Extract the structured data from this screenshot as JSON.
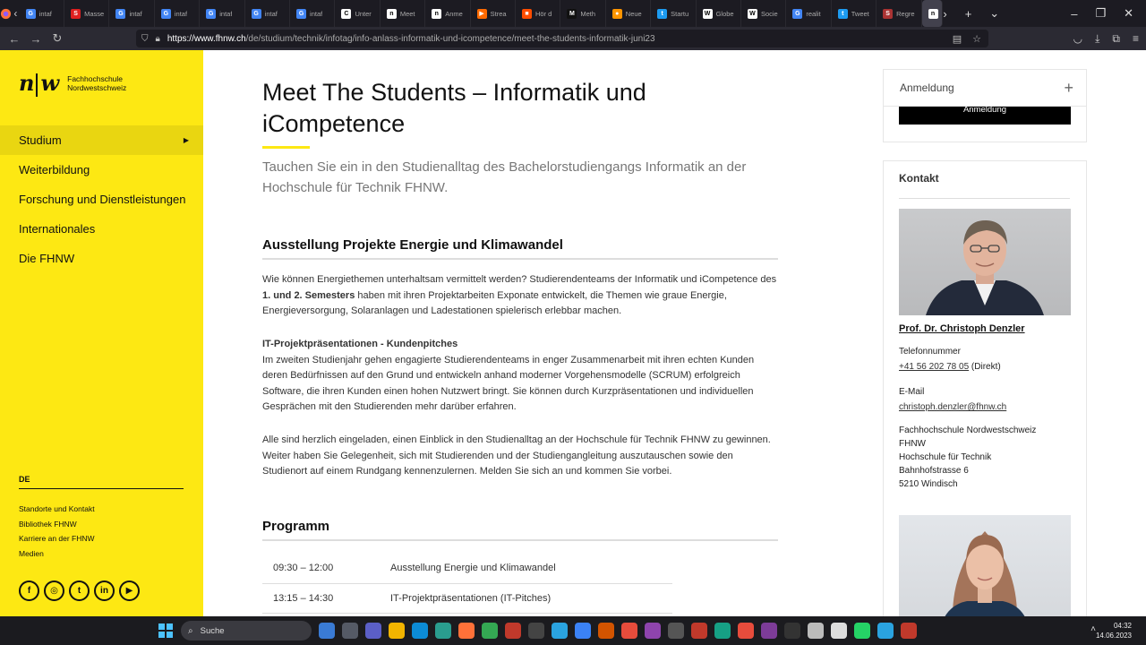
{
  "browser": {
    "tabs": [
      {
        "title": "intaf",
        "color": "#4285f4",
        "glyph": "G"
      },
      {
        "title": "Masse",
        "color": "#e02020",
        "glyph": "S"
      },
      {
        "title": "intaf",
        "color": "#4285f4",
        "glyph": "G"
      },
      {
        "title": "intaf",
        "color": "#4285f4",
        "glyph": "G"
      },
      {
        "title": "intaf",
        "color": "#4285f4",
        "glyph": "G"
      },
      {
        "title": "intaf",
        "color": "#4285f4",
        "glyph": "G"
      },
      {
        "title": "intaf",
        "color": "#4285f4",
        "glyph": "G"
      },
      {
        "title": "Unter",
        "color": "#ffffff",
        "glyph": "C"
      },
      {
        "title": "Meet",
        "color": "#ffffff",
        "glyph": "n"
      },
      {
        "title": "Anme",
        "color": "#ffffff",
        "glyph": "n"
      },
      {
        "title": "Strea",
        "color": "#ff6a00",
        "glyph": "▶"
      },
      {
        "title": "Hör d",
        "color": "#ff4d00",
        "glyph": "■"
      },
      {
        "title": "Meth",
        "color": "#111111",
        "glyph": "M"
      },
      {
        "title": "Neue",
        "color": "#ff9500",
        "glyph": "●"
      },
      {
        "title": "Startu",
        "color": "#1d9bf0",
        "glyph": "t"
      },
      {
        "title": "Globe",
        "color": "#ffffff",
        "glyph": "W"
      },
      {
        "title": "Socie",
        "color": "#ffffff",
        "glyph": "W"
      },
      {
        "title": "realit",
        "color": "#4285f4",
        "glyph": "G"
      },
      {
        "title": "Tweet",
        "color": "#1d9bf0",
        "glyph": "t"
      },
      {
        "title": "Regre",
        "color": "#aa3333",
        "glyph": "S"
      }
    ],
    "active_tab": {
      "title": "Me",
      "close": "✕"
    },
    "url_host": "https://www.fhnw.ch",
    "url_path": "/de/studium/technik/infotag/info-anlass-informatik-und-icompetence/meet-the-students-informatik-juni23"
  },
  "sidebar": {
    "logo_mark_left": "n",
    "logo_mark_right": "w",
    "logo_line1": "Fachhochschule",
    "logo_line2": "Nordwestschweiz",
    "nav": [
      {
        "label": "Studium"
      },
      {
        "label": "Weiterbildung"
      },
      {
        "label": "Forschung und Dienstleistungen"
      },
      {
        "label": "Internationales"
      },
      {
        "label": "Die FHNW"
      }
    ],
    "active_nav": "Studium",
    "language": "DE",
    "meta_links": [
      "Standorte und Kontakt",
      "Bibliothek FHNW",
      "Karriere an der FHNW",
      "Medien"
    ],
    "social": [
      "f",
      "◎",
      "t",
      "in",
      "▶"
    ]
  },
  "main": {
    "title": "Meet The Students – Informatik und iCompetence",
    "lead": "Tauchen Sie ein in den Studienalltag des Bachelorstudiengangs Informatik an der Hochschule für Technik FHNW.",
    "section1_heading": "Ausstellung Projekte Energie und Klimawandel",
    "p1_start": "Wie können Energiethemen unterhaltsam vermittelt werden? Studierendenteams der Informatik und iCompetence des ",
    "p1_bold": "1. und 2. Semesters",
    "p1_end": " haben mit ihren Projektarbeiten Exponate entwickelt, die Themen wie graue Energie, Energieversorgung, Solaranlagen und  Ladestationen spielerisch erlebbar machen.",
    "p2_bold": "IT-Projektpräsentationen - Kundenpitches",
    "p2_text": "Im zweiten Studienjahr gehen engagierte Studierendenteams in enger Zusammenarbeit mit ihren echten Kunden deren Bedürfnissen auf den Grund und entwickeln anhand moderner Vorgehensmodelle (SCRUM) erfolgreich Software, die ihren Kunden einen hohen Nutzwert bringt. Sie können durch Kurzpräsentationen und individuellen Gesprächen mit den Studierenden mehr darüber erfahren.",
    "p3": "Alle sind herzlich eingeladen, einen Einblick in den Studienalltag an der Hochschule für Technik FHNW zu gewinnen. Weiter haben Sie Gelegenheit, sich mit Studierenden und der Studiengangleitung auszutauschen sowie den Studienort auf einem Rundgang kennenzulernen. Melden Sie sich an und kommen Sie vorbei.",
    "programm_heading": "Programm",
    "programm": [
      {
        "time": "09:30 – 12:00",
        "item": "Ausstellung Energie und Klimawandel"
      },
      {
        "time": "13:15 – 14:30",
        "item": "IT-Projektpräsentationen (IT-Pitches)"
      }
    ]
  },
  "aside": {
    "anmeldung_heading": "Anmeldung",
    "anmeldung_toggle": "+",
    "anmeldung_button": "Anmeldung",
    "kontakt_heading": "Kontakt",
    "contact_name": "Prof. Dr. Christoph Denzler",
    "phone_label": "Telefonnummer",
    "phone": "+41 56 202 78 05",
    "phone_suffix": " (Direkt)",
    "email_label": "E-Mail",
    "email": "christoph.denzler@fhnw.ch",
    "address": [
      "Fachhochschule Nordwestschweiz",
      "FHNW",
      "Hochschule für Technik",
      "Bahnhofstrasse 6",
      "5210 Windisch"
    ]
  },
  "taskbar": {
    "search": "Suche",
    "time": "04:32",
    "date": "14.06.2023",
    "icons": [
      {
        "color": "#3a7bd5"
      },
      {
        "color": "#555a66"
      },
      {
        "color": "#5b5fc7"
      },
      {
        "color": "#f2b400"
      },
      {
        "color": "#0c8bd6"
      },
      {
        "color": "#2a9d8f"
      },
      {
        "color": "#ff7139"
      },
      {
        "color": "#34a853"
      },
      {
        "color": "#c0392b"
      },
      {
        "color": "#444444"
      },
      {
        "color": "#2aa3e0"
      },
      {
        "color": "#3b82f6"
      },
      {
        "color": "#d35400"
      },
      {
        "color": "#e74c3c"
      },
      {
        "color": "#8e44ad"
      },
      {
        "color": "#555555"
      },
      {
        "color": "#c0392b"
      },
      {
        "color": "#16a085"
      },
      {
        "color": "#e74c3c"
      },
      {
        "color": "#7d3c98"
      },
      {
        "color": "#333333"
      },
      {
        "color": "#bbbbbb"
      },
      {
        "color": "#dddddd"
      },
      {
        "color": "#25d366"
      },
      {
        "color": "#2aa3e0"
      },
      {
        "color": "#c0392b"
      }
    ]
  }
}
